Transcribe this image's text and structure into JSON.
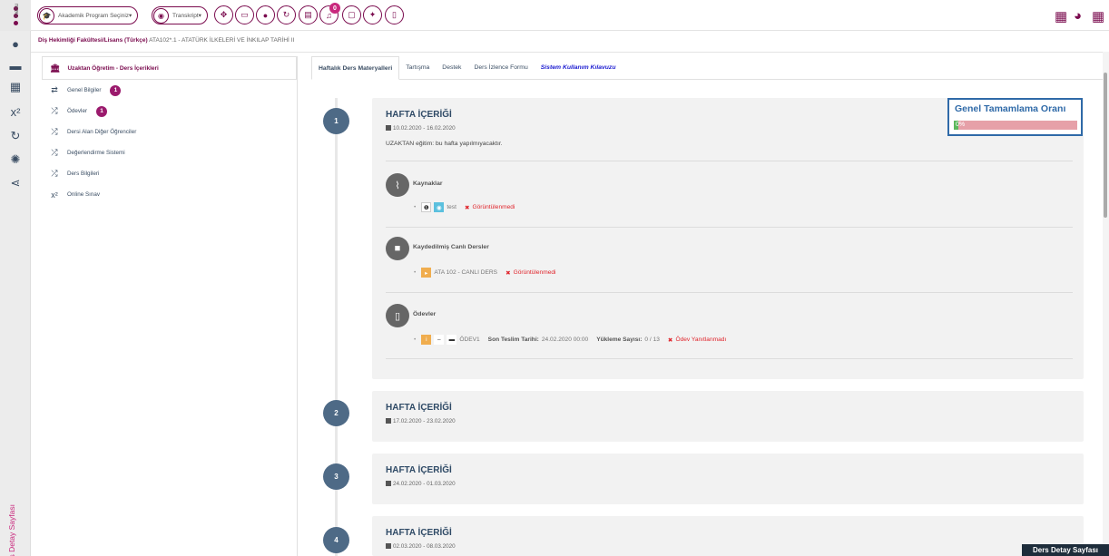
{
  "topbar": {
    "menu_label": "menu",
    "program_select": "Akademik Program Seçiniz",
    "transcript": "Transkript",
    "notification_count": "0"
  },
  "breadcrumb": {
    "faculty": "Diş Hekimliği Fakültesi/Lisans (Türkçe)",
    "course": " ATA102*.1 - ATATÜRK İLKELERİ VE İNKILAP TARİHİ II"
  },
  "sidebar": {
    "header": "Uzaktan Öğretim - Ders İçerikleri",
    "items": [
      {
        "label": "Genel Bilgiler",
        "badge": "1"
      },
      {
        "label": "Ödevler",
        "badge": "1"
      },
      {
        "label": "Dersi Alan Diğer Öğrenciler"
      },
      {
        "label": "Değerlendirme Sistemi"
      },
      {
        "label": "Ders Bilgileri"
      },
      {
        "label": "Online Sınav"
      }
    ],
    "vertical_label": "Ders Detay Sayfası"
  },
  "tabs": [
    "Haftalık Ders Materyalleri",
    "Tartışma",
    "Destek",
    "Ders İzlence Formu",
    "Sistem Kullanım Kılavuzu"
  ],
  "completion": {
    "title": "Genel Tamamlama Oranı",
    "percent": "0%",
    "value": 0.04
  },
  "weeks": [
    {
      "number": "1",
      "title": "HAFTA İÇERİĞİ",
      "date": "10.02.2020 - 16.02.2020",
      "note": "UZAKTAN eğitim: bu hafta yapılmıyacaktır.",
      "sections": {
        "resources": {
          "title": "Kaynaklar",
          "item": "test",
          "status": "Görüntülenmedi"
        },
        "live": {
          "title": "Kaydedilmiş Canlı Dersler",
          "item": "ATA 102 - CANLI DERS",
          "status": "Görüntülenmedi"
        },
        "homework": {
          "title": "Ödevler",
          "item": "ÖDEV1",
          "deadline_label": "Son Teslim Tarihi:",
          "deadline": "24.02.2020 00:00",
          "upload_label": "Yükleme Sayısı:",
          "upload": "0 / 13",
          "status": "Ödev Yanıtlanmadı"
        }
      }
    },
    {
      "number": "2",
      "title": "HAFTA İÇERİĞİ",
      "date": "17.02.2020 - 23.02.2020"
    },
    {
      "number": "3",
      "title": "HAFTA İÇERİĞİ",
      "date": "24.02.2020 - 01.03.2020"
    },
    {
      "number": "4",
      "title": "HAFTA İÇERİĞİ",
      "date": "02.03.2020 - 08.03.2020"
    }
  ],
  "footer_tag": "Ders Detay Sayfası"
}
